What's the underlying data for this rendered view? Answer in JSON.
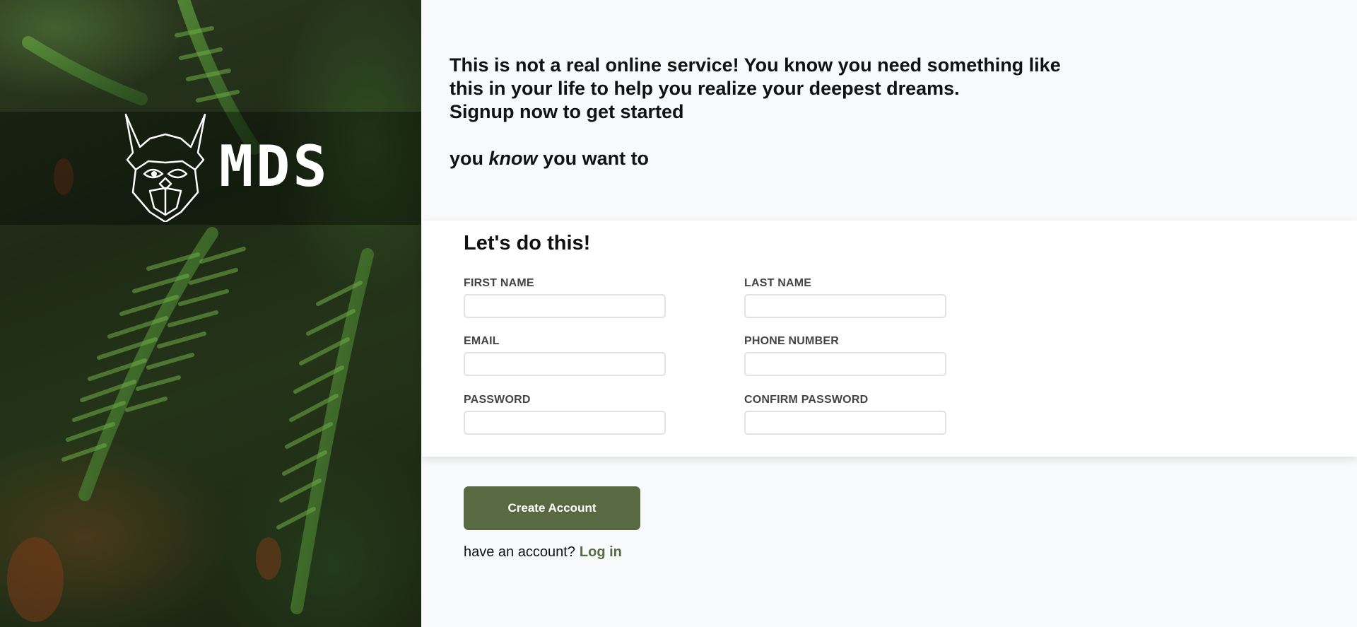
{
  "brand": {
    "logo_text": "MDS",
    "logo_icon": "viking-helmet-face-icon"
  },
  "intro": {
    "line1": "This is not a real online service! You know you need something like",
    "line2": "this in your life to help you realize your deepest dreams.",
    "line3": "Signup now to get started",
    "tagline_pre": "you",
    "tagline_em": "know",
    "tagline_post": "you want to"
  },
  "form": {
    "heading": "Let's do this!",
    "fields": [
      {
        "label": "FIRST NAME",
        "value": ""
      },
      {
        "label": "LAST NAME",
        "value": ""
      },
      {
        "label": "EMAIL",
        "value": ""
      },
      {
        "label": "PHONE NUMBER",
        "value": ""
      },
      {
        "label": "PASSWORD",
        "value": ""
      },
      {
        "label": "CONFIRM PASSWORD",
        "value": ""
      }
    ]
  },
  "actions": {
    "create_label": "Create Account",
    "login_prompt": "have an account?",
    "login_link": "Log in"
  },
  "colors": {
    "accent": "#596a43",
    "page_bg": "#f8f9fa",
    "card_bg": "#ffffff"
  }
}
